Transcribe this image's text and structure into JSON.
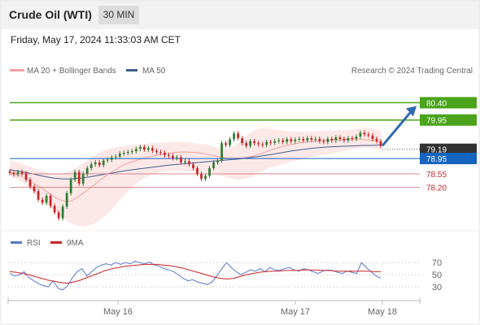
{
  "header": {
    "title": "Crude Oil (WTI)",
    "timeframe": "30 MIN",
    "timestamp": "Friday, May 17, 2024 11:33:03 AM CET"
  },
  "legend": {
    "ma20_bb": "MA 20 + Bollinger Bands",
    "ma50": "MA 50",
    "rsi": "RSI",
    "rsi_ma": "9MA"
  },
  "source": "Research © 2024 Trading Central",
  "colors": {
    "up_candle": "#2e7d32",
    "down_candle": "#c62828",
    "ma20": "#f1a0a0",
    "bollinger_fill": "#fde4e4",
    "ma50": "#3f5e8c",
    "resistance": "#4aa31a",
    "pivot": "#1565c0",
    "support": "#d8898b",
    "current_price_bg": "#333333",
    "arrow": "#2f6ab0",
    "rsi_line": "#5577cc",
    "rsi_ma": "#cc2222"
  },
  "chart_data": [
    {
      "type": "candlestick",
      "x_ticks": [
        "May 16",
        "May 17",
        "May 18"
      ],
      "y_range": [
        77.2,
        81.0
      ],
      "levels": [
        {
          "label": "80.40",
          "kind": "resistance"
        },
        {
          "label": "79.95",
          "kind": "resistance"
        },
        {
          "label": "79.19",
          "kind": "current"
        },
        {
          "label": "78.95",
          "kind": "pivot"
        },
        {
          "label": "78.55",
          "kind": "support"
        },
        {
          "label": "78.20",
          "kind": "support"
        }
      ],
      "close": [
        78.58,
        78.54,
        78.6,
        78.56,
        78.4,
        78.22,
        78.1,
        77.88,
        77.8,
        77.98,
        77.72,
        77.55,
        77.4,
        77.7,
        78.05,
        78.4,
        78.6,
        78.3,
        78.55,
        78.7,
        78.8,
        78.85,
        78.78,
        78.9,
        78.92,
        78.98,
        79.0,
        79.08,
        79.1,
        79.12,
        79.14,
        79.2,
        79.25,
        79.18,
        79.22,
        79.15,
        79.12,
        79.1,
        79.04,
        79.02,
        78.96,
        78.98,
        78.85,
        78.88,
        78.8,
        78.7,
        78.55,
        78.42,
        78.5,
        78.7,
        78.85,
        78.9,
        79.35,
        79.3,
        79.45,
        79.6,
        79.48,
        79.35,
        79.28,
        79.4,
        79.35,
        79.32,
        79.3,
        79.38,
        79.36,
        79.4,
        79.42,
        79.38,
        79.45,
        79.4,
        79.44,
        79.46,
        79.42,
        79.48,
        79.44,
        79.46,
        79.4,
        79.38,
        79.46,
        79.42,
        79.5,
        79.46,
        79.42,
        79.48,
        79.46,
        79.52,
        79.62,
        79.58,
        79.55,
        79.46,
        79.4,
        79.28
      ],
      "ma20": [
        78.6,
        78.55,
        78.49,
        78.42,
        78.34,
        78.25,
        78.16,
        78.06,
        77.96,
        77.88,
        77.84,
        77.85,
        77.92,
        78.02,
        78.13,
        78.24,
        78.35,
        78.46,
        78.56,
        78.65,
        78.74,
        78.81,
        78.86,
        78.91,
        78.95,
        78.99,
        79.02,
        79.05,
        79.07,
        79.09,
        79.11,
        79.12,
        79.12,
        79.11,
        79.1,
        79.08,
        79.05,
        79.02,
        78.99,
        78.97,
        78.96,
        78.96,
        78.97,
        78.99,
        79.02,
        79.06,
        79.11,
        79.16,
        79.21,
        79.25,
        79.29,
        79.32,
        79.35,
        79.37,
        79.39,
        79.4,
        79.41,
        79.42,
        79.43,
        79.44,
        79.44,
        79.45,
        79.45,
        79.45,
        79.44,
        79.43,
        79.41,
        79.38
      ],
      "ma50": [
        78.66,
        78.62,
        78.58,
        78.53,
        78.48,
        78.44,
        78.42,
        78.42,
        78.44,
        78.47,
        78.51,
        78.55,
        78.59,
        78.63,
        78.66,
        78.69,
        78.72,
        78.75,
        78.78,
        78.8,
        78.82,
        78.84,
        78.86,
        78.88,
        78.9,
        78.92,
        78.94,
        78.97,
        79.0,
        79.03,
        79.07,
        79.11,
        79.15,
        79.18,
        79.21,
        79.23,
        79.25,
        79.26,
        79.27,
        79.28,
        79.29,
        79.29,
        79.3
      ],
      "bb_upper": [
        78.9,
        78.85,
        78.78,
        78.7,
        78.62,
        78.56,
        78.55,
        78.6,
        78.7,
        78.85,
        79.0,
        79.12,
        79.2,
        79.25,
        79.28,
        79.3,
        79.32,
        79.35,
        79.36,
        79.37,
        79.38,
        79.38,
        79.36,
        79.33,
        79.3,
        79.25,
        79.2,
        79.25,
        79.4,
        79.6,
        79.72,
        79.75,
        79.72,
        79.68,
        79.66,
        79.65,
        79.65,
        79.66,
        79.67,
        79.68,
        79.68,
        79.7,
        79.72,
        79.75,
        79.73,
        79.68
      ],
      "bb_lower": [
        78.5,
        78.4,
        78.25,
        78.05,
        77.85,
        77.65,
        77.45,
        77.3,
        77.2,
        77.18,
        77.25,
        77.4,
        77.6,
        77.85,
        78.1,
        78.3,
        78.45,
        78.55,
        78.6,
        78.62,
        78.63,
        78.62,
        78.6,
        78.58,
        78.55,
        78.5,
        78.45,
        78.4,
        78.42,
        78.5,
        78.62,
        78.72,
        78.78,
        78.84,
        78.9,
        78.95,
        79.0,
        79.04,
        79.08,
        79.12,
        79.16,
        79.2,
        79.24,
        79.22,
        79.16
      ]
    },
    {
      "type": "line",
      "name": "RSI",
      "y_ticks": [
        "70",
        "50",
        "30"
      ],
      "y_range": [
        10,
        85
      ],
      "series": [
        {
          "name": "RSI",
          "values": [
            52,
            48,
            50,
            55,
            45,
            40,
            35,
            32,
            30,
            40,
            28,
            25,
            32,
            45,
            55,
            60,
            48,
            55,
            62,
            66,
            68,
            66,
            70,
            67,
            70,
            68,
            72,
            70,
            68,
            71,
            66,
            64,
            60,
            58,
            55,
            50,
            44,
            40,
            42,
            38,
            36,
            34,
            38,
            48,
            60,
            70,
            62,
            55,
            50,
            54,
            58,
            56,
            60,
            55,
            62,
            58,
            57,
            60,
            62,
            58,
            56,
            60,
            58,
            55,
            52,
            56,
            58,
            57,
            54,
            52,
            56,
            54,
            52,
            70,
            62,
            55,
            48,
            44
          ]
        },
        {
          "name": "9MA",
          "values": [
            55,
            54,
            52,
            50,
            47,
            44,
            41,
            39,
            37,
            36,
            38,
            41,
            45,
            49,
            53,
            57,
            60,
            62,
            64,
            65,
            66,
            67,
            67,
            67,
            66,
            65,
            63,
            61,
            58,
            55,
            52,
            49,
            46,
            44,
            43,
            44,
            47,
            50,
            52,
            54,
            55,
            56,
            56,
            57,
            57,
            57,
            58,
            58,
            58,
            57,
            57,
            56,
            56,
            56,
            56,
            56,
            56,
            55,
            55
          ]
        }
      ]
    }
  ]
}
